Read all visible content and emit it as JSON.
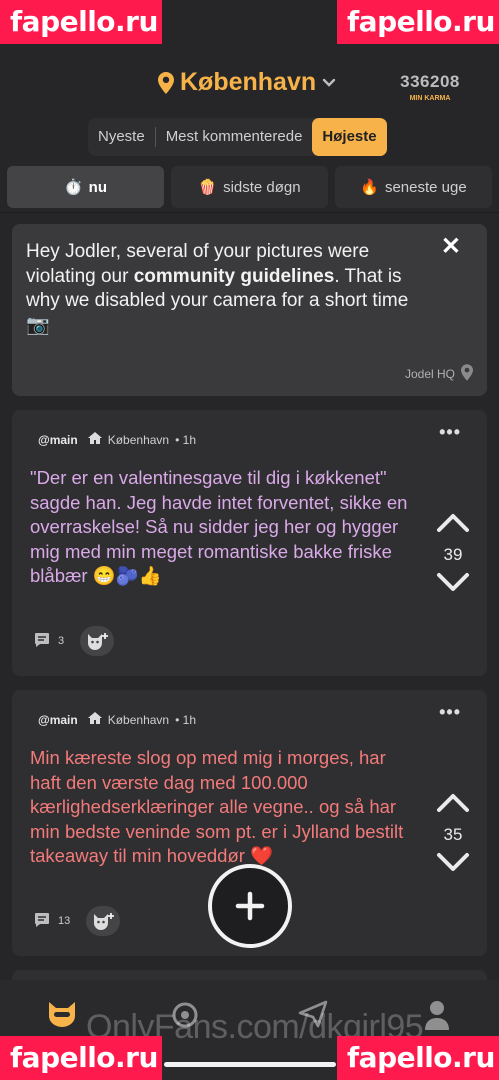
{
  "watermarks": [
    "fapello.ru",
    "fapello.ru",
    "fapello.ru",
    "fapello.ru"
  ],
  "header": {
    "location": "København",
    "karma_value": "336208",
    "karma_label": "MIN KARMA"
  },
  "sort": {
    "options": [
      "Nyeste",
      "Mest kommenterede",
      "Højeste"
    ],
    "active": "Højeste"
  },
  "tabs": [
    {
      "label": "nu",
      "emoji": "⏱️"
    },
    {
      "label": "sidste døgn",
      "emoji": "🍿"
    },
    {
      "label": "seneste uge",
      "emoji": "🔥"
    }
  ],
  "notice": {
    "text_before": "Hey Jodler, several of your pictures were violating our ",
    "text_bold": "community guidelines",
    "text_after": ". That is why we disabled your camera for a short time 📷",
    "author": "Jodel HQ",
    "close": "✕"
  },
  "posts": [
    {
      "channel": "@main",
      "location": "København",
      "time": "• 1h",
      "text": "\"Der er en valentinesgave til dig i køkkenet\" sagde han. Jeg havde intet forventet, sikke en overraskelse! Så nu sidder jeg her og hygger mig med min meget romantiske bakke friske blåbær 😁🫐👍",
      "votes": "39",
      "comments": "3",
      "text_color": "#d9a9e8"
    },
    {
      "channel": "@main",
      "location": "København",
      "time": "• 1h",
      "text": "Min kæreste slog op med mig i morges, har haft den værste dag med 100.000 kærlighedserklæringer alle vegne.. og så har min bedste veninde som pt. er i Jylland  bestilt takeaway til min hoveddør ❤️",
      "votes": "35",
      "comments": "13",
      "text_color": "#f27a7a"
    }
  ],
  "overlay_text": "OnlyFans.com/dkgirl95",
  "nav": [
    "cat-icon",
    "channels-icon",
    "send-icon",
    "profile-icon"
  ],
  "colors": {
    "accent": "#f7b34a",
    "background": "#262628",
    "card": "#2f2f31",
    "watermark": "#ff1a4e"
  }
}
